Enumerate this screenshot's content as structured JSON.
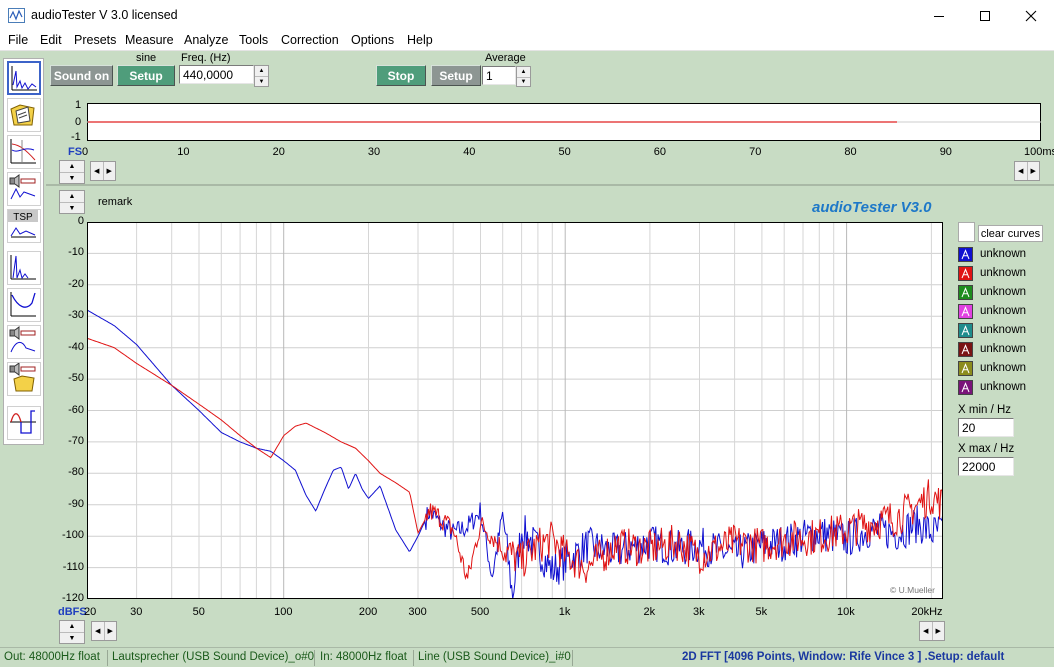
{
  "window": {
    "app_name": "audioTester",
    "title": "audioTester  V 3.0   licensed"
  },
  "menu": [
    "File",
    "Edit",
    "Presets",
    "Measure",
    "Analyze",
    "Tools",
    "Correction",
    "Options",
    "Help"
  ],
  "generator": {
    "sound_button": "Sound on",
    "mode_label": "sine",
    "setup_button": "Setup",
    "freq_label": "Freq. (Hz)",
    "freq_value": "440,0000"
  },
  "analyzer": {
    "stop_button": "Stop",
    "setup_button": "Setup",
    "average_label": "Average",
    "average_value": "1"
  },
  "scope": {
    "y_ticks": [
      "1",
      "0",
      "-1"
    ],
    "x_unit_label": "FS",
    "x_ticks": [
      "0",
      "10",
      "20",
      "30",
      "40",
      "50",
      "60",
      "70",
      "80",
      "90",
      "100ms"
    ],
    "trace_color": "#e02020",
    "trace_end_ms": 85
  },
  "fft": {
    "remark_label": "remark",
    "brand": "audioTester  V3.0",
    "y_unit_label": "dBFS",
    "y_ticks": [
      "0",
      "-10",
      "-20",
      "-30",
      "-40",
      "-50",
      "-60",
      "-70",
      "-80",
      "-90",
      "-100",
      "-110",
      "-120"
    ],
    "x_ticks": [
      "20",
      "30",
      "50",
      "100",
      "200",
      "300",
      "500",
      "1k",
      "2k",
      "3k",
      "5k",
      "10k",
      "20kHz"
    ],
    "copyright": "© U.Mueller"
  },
  "legend": {
    "clear_button": "clear curves",
    "curves": [
      {
        "label": "unknown",
        "color": "#1010d0"
      },
      {
        "label": "unknown",
        "color": "#e01414"
      },
      {
        "label": "unknown",
        "color": "#1e8c1e"
      },
      {
        "label": "unknown",
        "color": "#e040e0"
      },
      {
        "label": "unknown",
        "color": "#1e8c8c"
      },
      {
        "label": "unknown",
        "color": "#7a1414"
      },
      {
        "label": "unknown",
        "color": "#8c8c1e"
      },
      {
        "label": "unknown",
        "color": "#7a147a"
      }
    ],
    "icon_letter": "A",
    "xmin_label": "X min / Hz",
    "xmin_value": "20",
    "xmax_label": "X max / Hz",
    "xmax_value": "22000"
  },
  "status": {
    "out": "Out: 48000Hz float",
    "out_device": "Lautsprecher (USB Sound Device)_o#0",
    "in": "In: 48000Hz float",
    "in_device": "Line (USB Sound Device)_i#0",
    "fft_info": "2D FFT [4096 Points, Window: Rife Vince 3 ]  .Setup:  default"
  },
  "toolbox": {
    "tsp_label": "TSP"
  },
  "chart_data": {
    "type": "line",
    "xscale": "log",
    "xlim": [
      20,
      22000
    ],
    "ylim": [
      -120,
      0
    ],
    "xlabel": "",
    "ylabel": "dBFS",
    "grid": true,
    "series": [
      {
        "name": "unknown",
        "color": "#1010d0",
        "x": [
          20,
          25,
          30,
          40,
          50,
          60,
          70,
          80,
          90,
          100,
          110,
          120,
          130,
          140,
          150,
          160,
          170,
          180,
          190,
          200,
          220,
          250,
          280,
          300,
          330,
          360,
          400,
          450,
          500,
          550,
          600,
          650,
          700,
          800,
          900,
          1000,
          1200,
          1500,
          2000,
          2500,
          3000,
          4000,
          5000,
          6000,
          8000,
          10000,
          12000,
          15000,
          18000,
          20000,
          22000
        ],
        "y": [
          -28,
          -33,
          -39,
          -52,
          -60,
          -67,
          -70,
          -72,
          -73,
          -76,
          -79,
          -87,
          -92,
          -85,
          -79,
          -78,
          -85,
          -80,
          -85,
          -88,
          -84,
          -98,
          -105,
          -100,
          -92,
          -96,
          -99,
          -97,
          -92,
          -113,
          -93,
          -119,
          -98,
          -104,
          -111,
          -108,
          -103,
          -105,
          -102,
          -104,
          -103,
          -106,
          -103,
          -102,
          -99,
          -101,
          -98,
          -99,
          -96,
          -99,
          -98
        ]
      },
      {
        "name": "unknown",
        "color": "#e01414",
        "x": [
          20,
          25,
          30,
          40,
          50,
          60,
          70,
          80,
          90,
          100,
          110,
          120,
          140,
          160,
          180,
          200,
          220,
          250,
          280,
          300,
          330,
          360,
          400,
          450,
          500,
          550,
          600,
          700,
          800,
          900,
          1000,
          1200,
          1500,
          2000,
          2500,
          3000,
          4000,
          5000,
          6000,
          8000,
          10000,
          12000,
          15000,
          18000,
          20000,
          22000
        ],
        "y": [
          -37,
          -40,
          -45,
          -52,
          -58,
          -63,
          -68,
          -72,
          -75,
          -68,
          -65,
          -64,
          -67,
          -70,
          -72,
          -76,
          -80,
          -83,
          -86,
          -99,
          -92,
          -94,
          -98,
          -114,
          -96,
          -100,
          -104,
          -108,
          -103,
          -101,
          -106,
          -110,
          -103,
          -104,
          -102,
          -106,
          -102,
          -103,
          -101,
          -100,
          -98,
          -96,
          -94,
          -90,
          -87,
          -90
        ]
      }
    ]
  }
}
